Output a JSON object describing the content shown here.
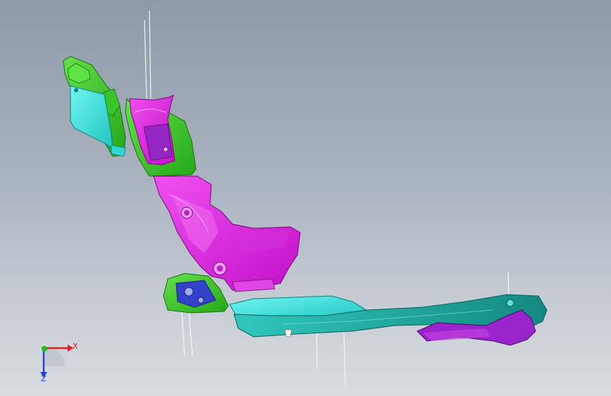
{
  "viewport": {
    "background_top": "#8e9aa9",
    "background_bottom": "#d9dde2"
  },
  "model": {
    "colors": {
      "magenta": "#e020e0",
      "green": "#33cc22",
      "cyan": "#22dddd",
      "purple": "#9922cc",
      "blue": "#3344cc",
      "teal": "#22aaa0"
    }
  },
  "triad": {
    "x_label": "X",
    "y_label": "Z",
    "x_color": "#e02020",
    "y_color": "#2040e0",
    "origin_color": "#20c020"
  }
}
